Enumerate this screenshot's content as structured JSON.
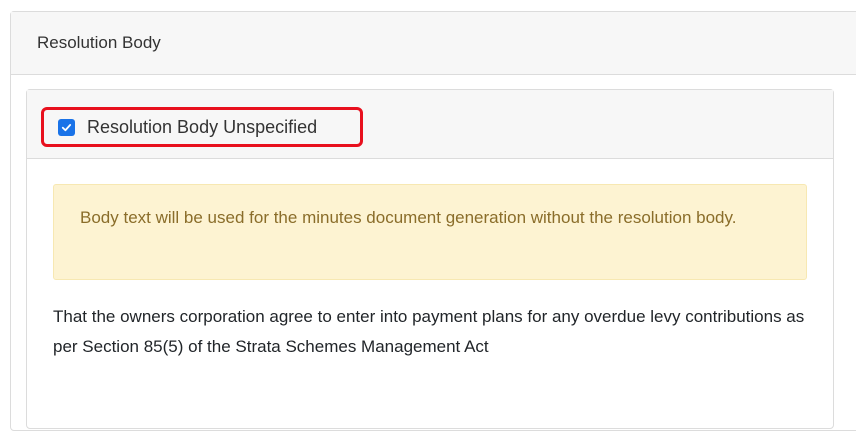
{
  "outer_card": {
    "title": "Resolution Body"
  },
  "inner_card": {
    "checkbox": {
      "label": "Resolution Body Unspecified",
      "checked": true
    },
    "alert": {
      "text": "Body text will be used for the minutes document generation without the resolution body."
    },
    "body_text": "That the owners corporation agree to enter into payment plans for any overdue levy contributions as per Section 85(5) of the Strata Schemes Management Act"
  },
  "colors": {
    "checkbox_fill": "#1a73e8",
    "highlight_border": "#e8101e",
    "alert_background": "#fdf3d2",
    "alert_text": "#8a6d2a"
  }
}
